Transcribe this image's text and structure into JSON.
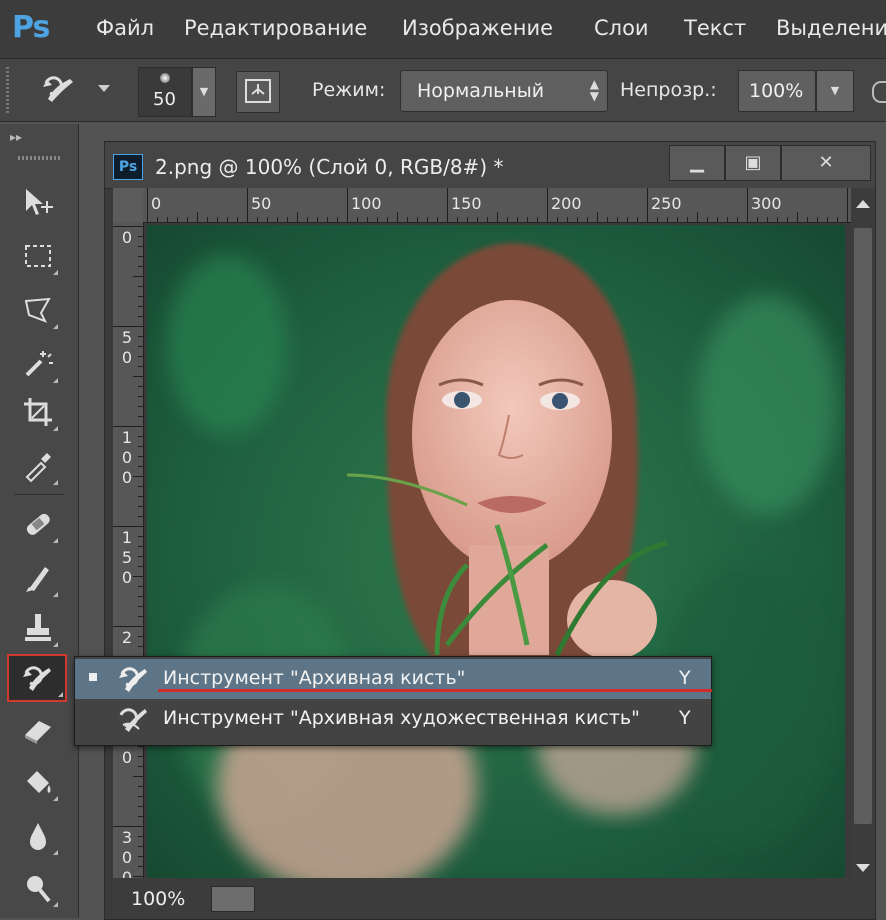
{
  "app": {
    "logo": "Ps",
    "menu": [
      "Файл",
      "Редактирование",
      "Изображение",
      "Слои",
      "Текст",
      "Выделени"
    ]
  },
  "options": {
    "brush_size": "50",
    "mode_label": "Режим:",
    "mode_value": "Нормальный",
    "opacity_label": "Непрозр.:",
    "opacity_value": "100%"
  },
  "document": {
    "icon": "Ps",
    "title": "2.png @ 100% (Слой 0, RGB/8#) *",
    "window_buttons": [
      "minimize-icon",
      "maximize-icon",
      "close-icon"
    ],
    "zoom": "100%",
    "ruler_h": [
      "0",
      "50",
      "100",
      "150",
      "200",
      "250",
      "300"
    ],
    "ruler_v": [
      "0",
      "5\n0",
      "1\n0\n0",
      "1\n5\n0",
      "2",
      "5\n0",
      "3\n0\n0"
    ]
  },
  "flyout": {
    "items": [
      {
        "label": "Инструмент \"Архивная кисть\"",
        "key": "Y",
        "selected": true,
        "icon": "history-brush-icon"
      },
      {
        "label": "Инструмент \"Архивная художественная кисть\"",
        "key": "Y",
        "selected": false,
        "icon": "art-history-brush-icon"
      }
    ]
  },
  "colors": {
    "accent": "#4ea3e3",
    "highlight": "#d02a2a",
    "selection": "#5e7587"
  }
}
